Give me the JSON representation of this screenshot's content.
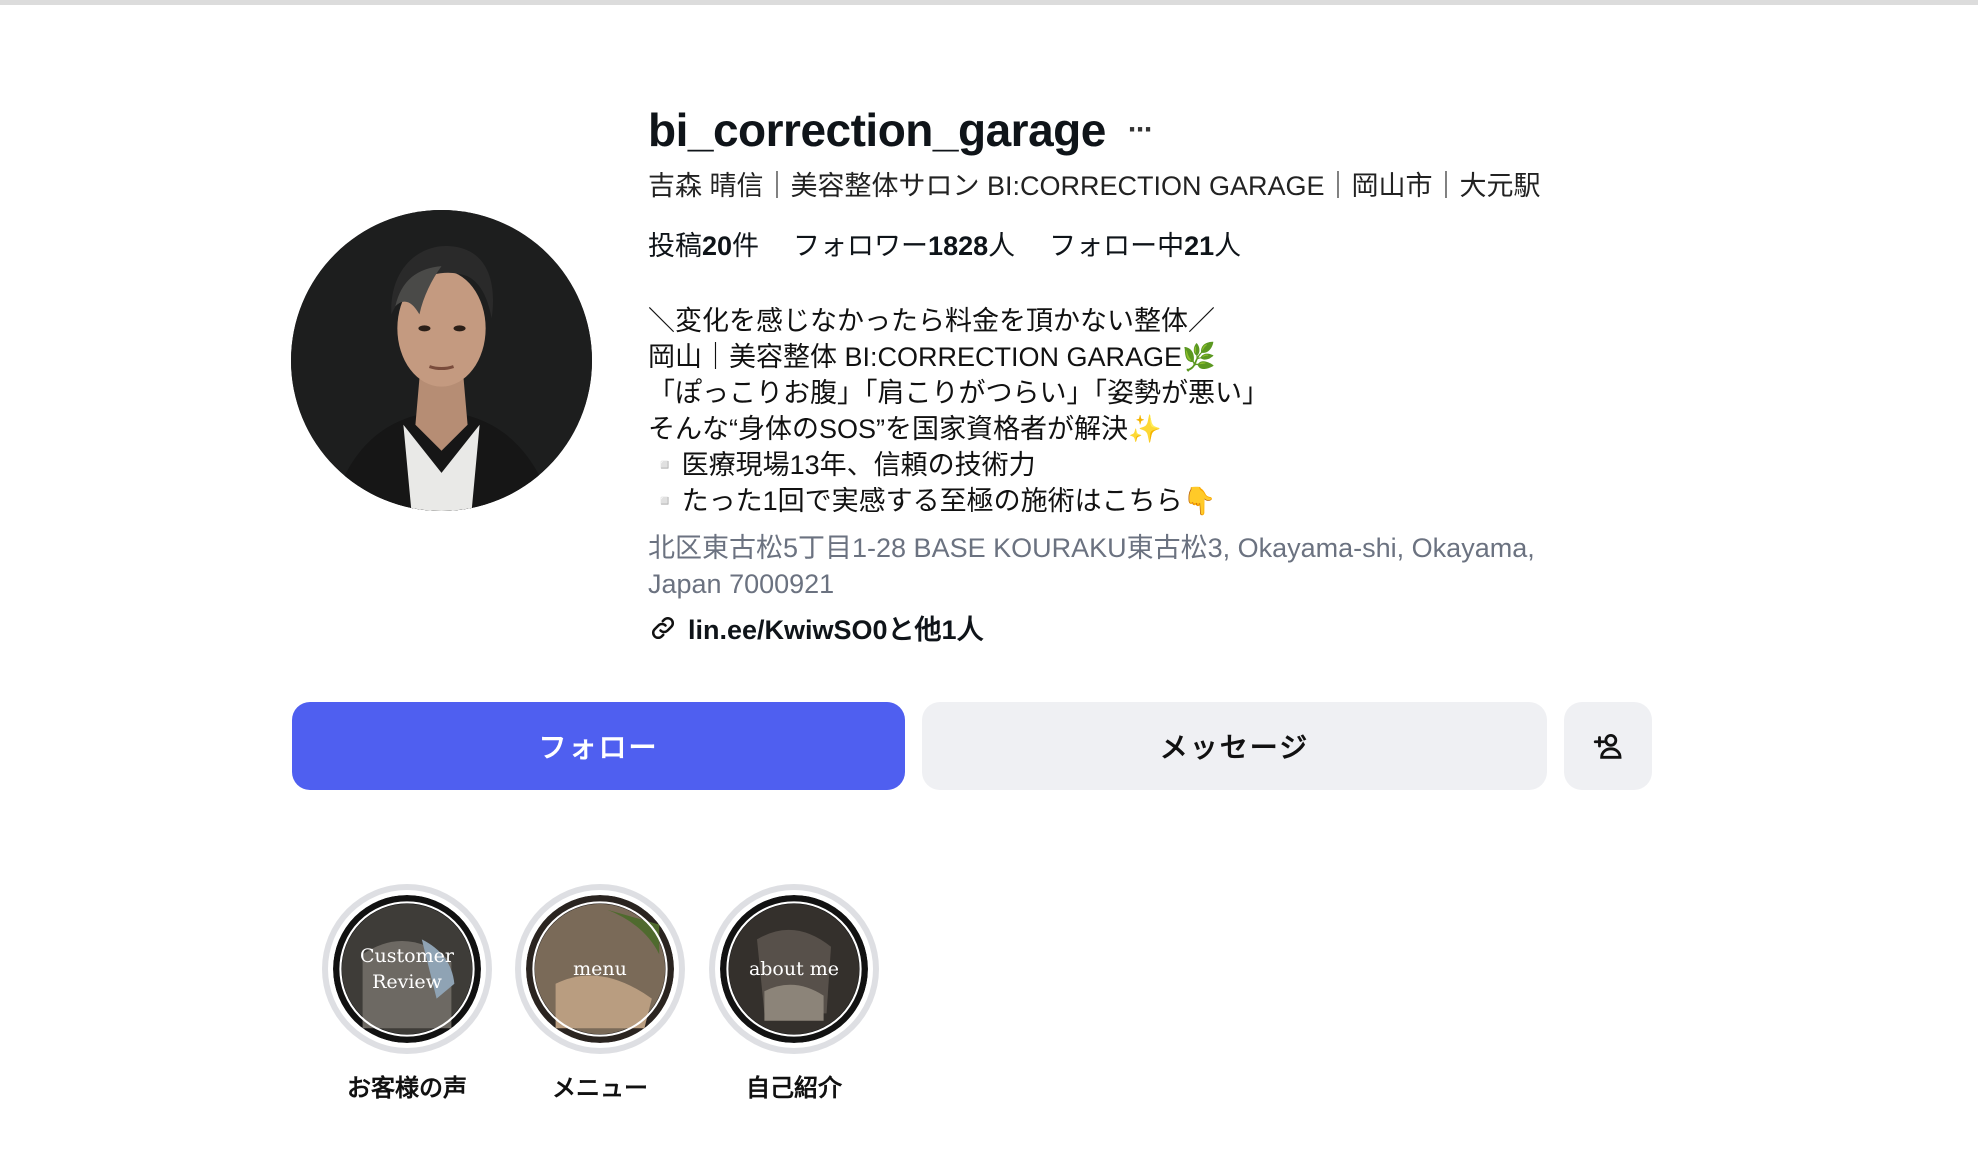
{
  "profile": {
    "username": "bi_correction_garage",
    "more_icon": "ellipsis-icon",
    "full_name": "吉森 晴信｜美容整体サロン BI:CORRECTION GARAGE｜岡山市｜大元駅",
    "stats": {
      "posts_label": "投稿",
      "posts_value": "20",
      "posts_unit": "件",
      "followers_label": "フォロワー",
      "followers_value": "1828",
      "followers_unit": "人",
      "following_label": "フォロー中",
      "following_value": "21",
      "following_unit": "人"
    },
    "bio": [
      "＼変化を感じなかったら料金を頂かない整体／",
      "岡山｜美容整体 BI:CORRECTION GARAGE🌿",
      "「ぽっこりお腹」「肩こりがつらい」「姿勢が悪い」",
      "そんな“身体のSOS”を国家資格者が解決✨",
      "▫️医療現場13年、信頼の技術力",
      "▫️たった1回で実感する至極の施術はこちら👇"
    ],
    "address": "北区東古松5丁目1-28 BASE KOURAKU東古松3, Okayama-shi, Okayama, Japan 7000921",
    "link_icon": "link-icon",
    "link_text": "lin.ee/KwiwSO0と他1人"
  },
  "actions": {
    "follow_label": "フォロー",
    "message_label": "メッセージ",
    "suggest_icon": "add-person-icon"
  },
  "highlights": [
    {
      "caption": "Customer Review",
      "label": "お客様の声"
    },
    {
      "caption": "menu",
      "label": "メニュー"
    },
    {
      "caption": "about me",
      "label": "自己紹介"
    }
  ],
  "colors": {
    "follow_button": "#4f5ff0",
    "secondary_button": "#eff0f3",
    "address_text": "#6b7280"
  }
}
